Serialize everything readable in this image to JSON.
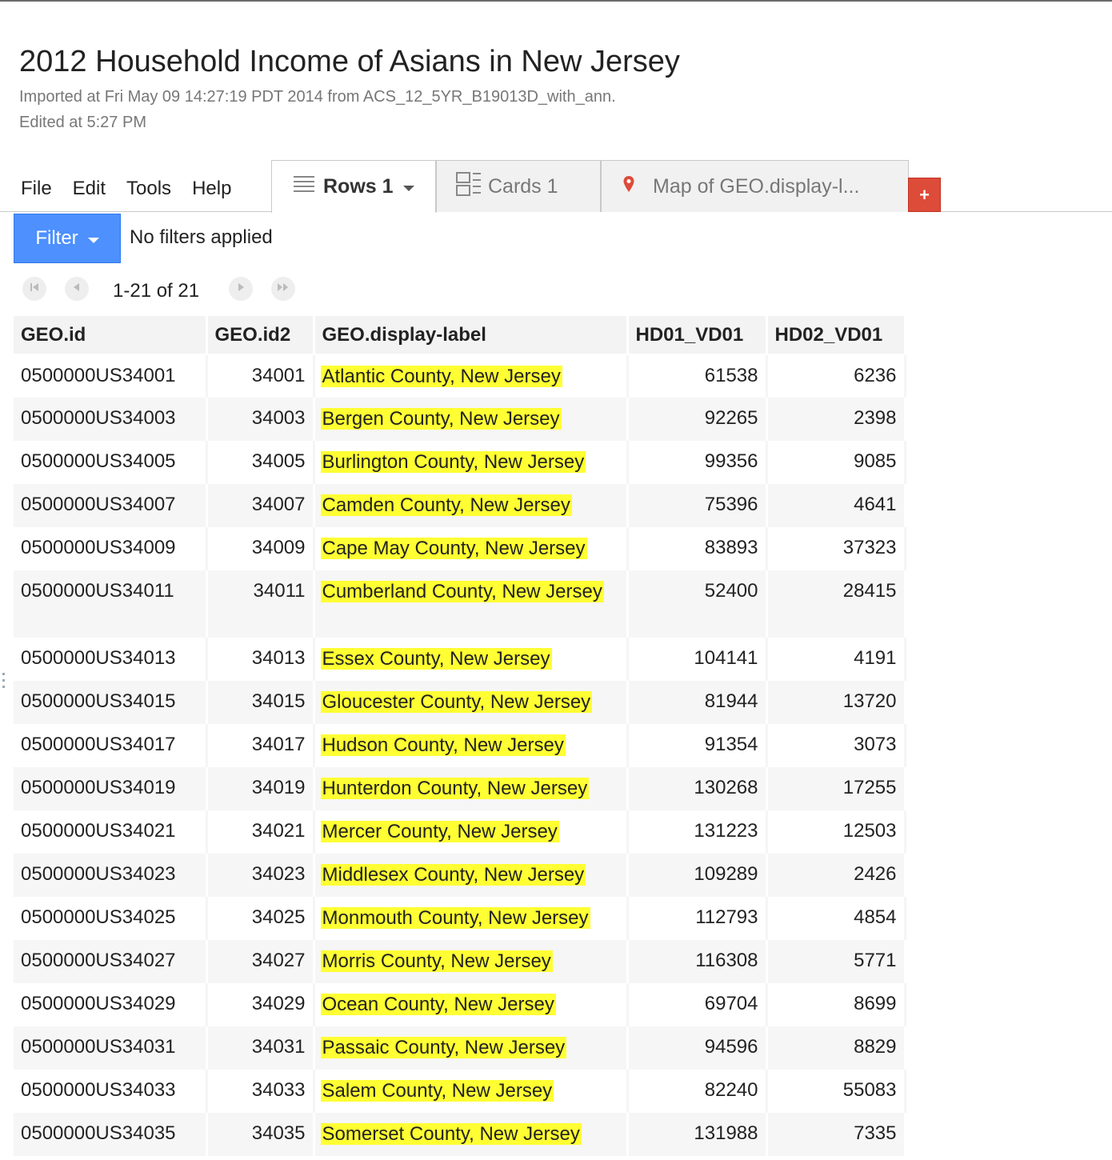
{
  "header": {
    "title": "2012 Household Income of Asians in New Jersey",
    "imported": "Imported at Fri May 09 14:27:19 PDT 2014 from ACS_12_5YR_B19013D_with_ann.",
    "edited": "Edited at 5:27 PM"
  },
  "menu": [
    "File",
    "Edit",
    "Tools",
    "Help"
  ],
  "tabs": {
    "rows": "Rows 1",
    "cards": "Cards 1",
    "map": "Map of GEO.display-l...",
    "add": "+"
  },
  "filter": {
    "button": "Filter",
    "status": "No filters applied"
  },
  "pager": {
    "range": "1-21 of 21"
  },
  "icons": {
    "rows": "list-icon",
    "cards": "cards-icon",
    "map": "map-pin-icon",
    "first": "first-page-icon",
    "prev": "prev-page-icon",
    "next": "next-page-icon",
    "last": "last-page-icon"
  },
  "colors": {
    "filter_blue": "#4d90fe",
    "add_red": "#dd4b39",
    "highlight": "#ffff33",
    "pin_red": "#dd4b39"
  },
  "table": {
    "columns": [
      "GEO.id",
      "GEO.id2",
      "GEO.display-label",
      "HD01_VD01",
      "HD02_VD01"
    ],
    "rows": [
      [
        "0500000US34001",
        "34001",
        "Atlantic County, New Jersey",
        "61538",
        "6236"
      ],
      [
        "0500000US34003",
        "34003",
        "Bergen County, New Jersey",
        "92265",
        "2398"
      ],
      [
        "0500000US34005",
        "34005",
        "Burlington County, New Jersey",
        "99356",
        "9085"
      ],
      [
        "0500000US34007",
        "34007",
        "Camden County, New Jersey",
        "75396",
        "4641"
      ],
      [
        "0500000US34009",
        "34009",
        "Cape May County, New Jersey",
        "83893",
        "37323"
      ],
      [
        "0500000US34011",
        "34011",
        "Cumberland County, New Jersey",
        "52400",
        "28415"
      ],
      [
        "0500000US34013",
        "34013",
        "Essex County, New Jersey",
        "104141",
        "4191"
      ],
      [
        "0500000US34015",
        "34015",
        "Gloucester County, New Jersey",
        "81944",
        "13720"
      ],
      [
        "0500000US34017",
        "34017",
        "Hudson County, New Jersey",
        "91354",
        "3073"
      ],
      [
        "0500000US34019",
        "34019",
        "Hunterdon County, New Jersey",
        "130268",
        "17255"
      ],
      [
        "0500000US34021",
        "34021",
        "Mercer County, New Jersey",
        "131223",
        "12503"
      ],
      [
        "0500000US34023",
        "34023",
        "Middlesex County, New Jersey",
        "109289",
        "2426"
      ],
      [
        "0500000US34025",
        "34025",
        "Monmouth County, New Jersey",
        "112793",
        "4854"
      ],
      [
        "0500000US34027",
        "34027",
        "Morris County, New Jersey",
        "116308",
        "5771"
      ],
      [
        "0500000US34029",
        "34029",
        "Ocean County, New Jersey",
        "69704",
        "8699"
      ],
      [
        "0500000US34031",
        "34031",
        "Passaic County, New Jersey",
        "94596",
        "8829"
      ],
      [
        "0500000US34033",
        "34033",
        "Salem County, New Jersey",
        "82240",
        "55083"
      ],
      [
        "0500000US34035",
        "34035",
        "Somerset County, New Jersey",
        "131988",
        "7335"
      ]
    ]
  }
}
